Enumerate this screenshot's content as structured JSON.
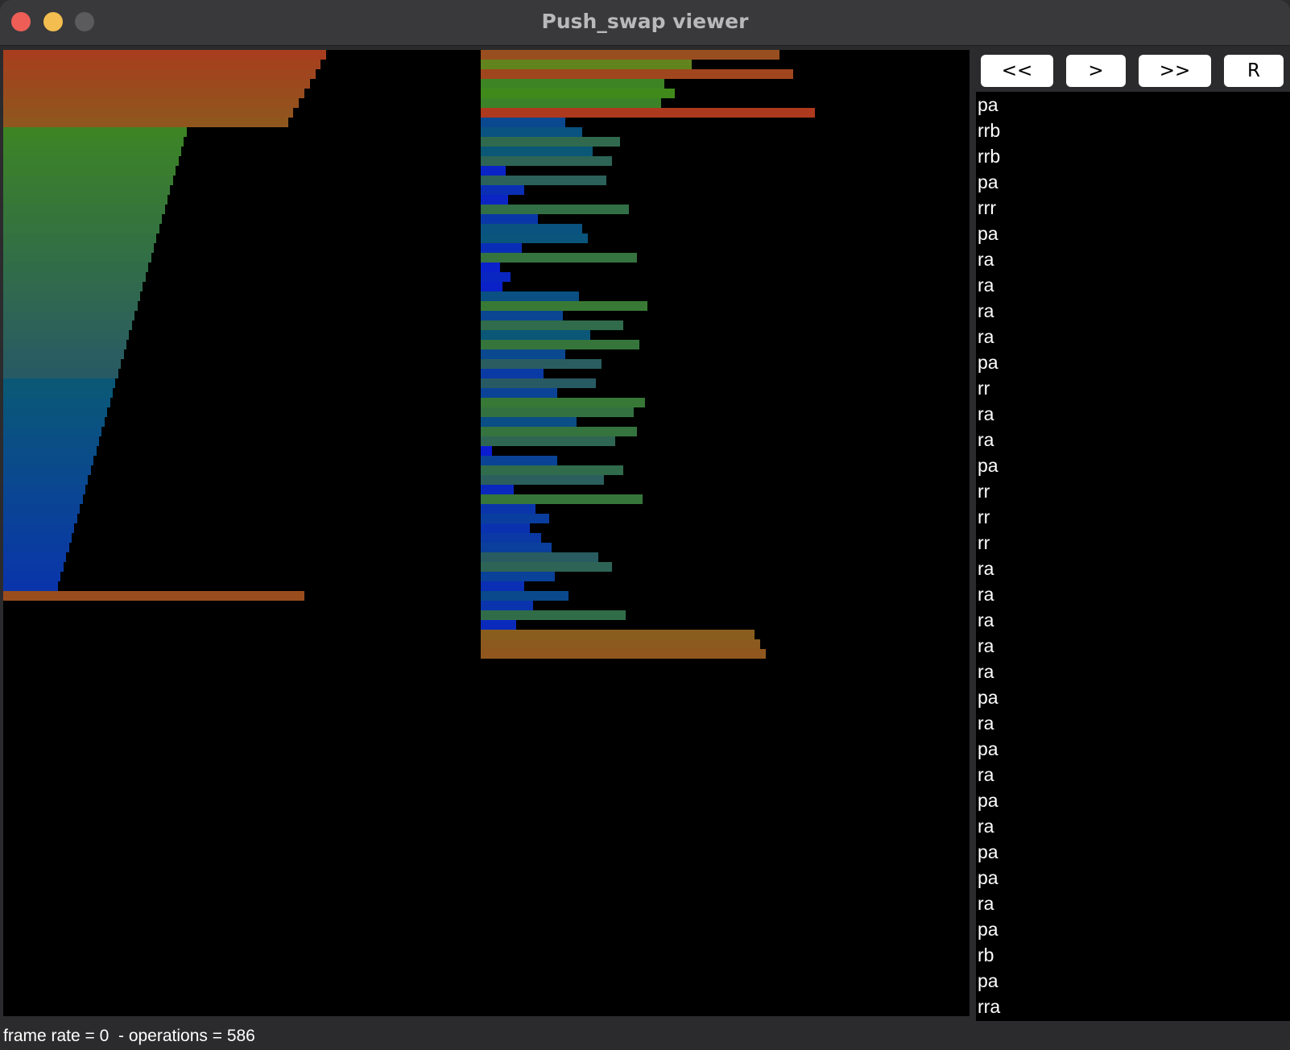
{
  "window": {
    "title": "Push_swap viewer"
  },
  "controls": {
    "first_label": "<<",
    "step_label": ">",
    "play_label": ">>",
    "reset_label": "R"
  },
  "operations": [
    "pa",
    "rrb",
    "rrb",
    "pa",
    "rrr",
    "pa",
    "ra",
    "ra",
    "ra",
    "ra",
    "pa",
    "rr",
    "ra",
    "ra",
    "pa",
    "rr",
    "rr",
    "rr",
    "ra",
    "ra",
    "ra",
    "ra",
    "ra",
    "pa",
    "ra",
    "pa",
    "ra",
    "pa",
    "ra",
    "pa",
    "pa",
    "ra",
    "pa",
    "rb",
    "pa",
    "rra"
  ],
  "status": {
    "frame_rate_text": "frame rate = 0",
    "operations_text": "operations = 586"
  },
  "colors": {
    "canvas": "#000000",
    "orange": "#8e501e",
    "red_orange": "#a03c19",
    "green": "#4f8c22",
    "blue": "#0a14dc",
    "teal": "#2a5a5a"
  },
  "visualizer": {
    "stack_a_values": [
      118,
      116,
      114,
      112,
      110,
      108,
      106,
      104,
      67,
      66,
      65,
      64,
      63,
      62,
      61,
      60,
      59,
      58,
      57,
      56,
      55,
      54,
      53,
      52,
      51,
      50,
      49,
      48,
      47,
      46,
      45,
      44,
      43,
      42,
      41,
      40,
      39,
      38,
      37,
      36,
      35,
      34,
      33,
      32,
      31,
      30,
      29,
      28,
      27,
      26,
      25,
      24,
      23,
      22,
      21,
      20,
      110
    ],
    "stack_b_values": [
      109,
      77,
      114,
      67,
      71,
      66,
      122,
      31,
      37,
      51,
      41,
      48,
      9,
      46,
      16,
      10,
      54,
      21,
      37,
      39,
      15,
      57,
      7,
      11,
      8,
      36,
      61,
      30,
      52,
      40,
      58,
      31,
      44,
      23,
      42,
      28,
      60,
      56,
      35,
      57,
      49,
      4,
      28,
      52,
      45,
      12,
      59,
      20,
      25,
      18,
      22,
      26,
      43,
      48,
      27,
      16,
      32,
      19,
      53,
      13,
      100,
      102,
      104
    ],
    "max_value": 120
  }
}
